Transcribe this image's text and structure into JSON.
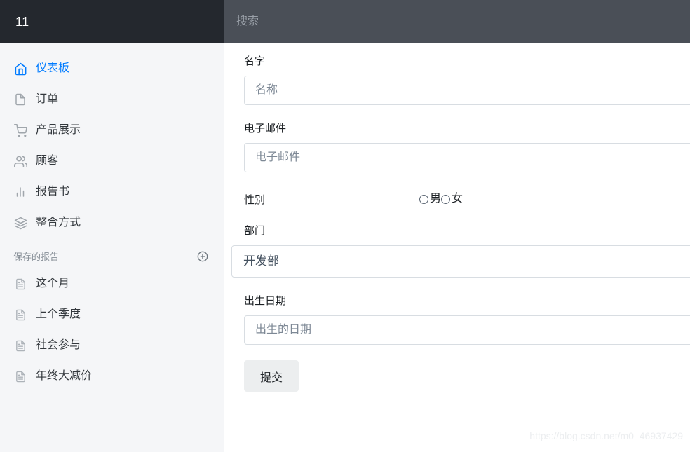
{
  "header": {
    "brand": "11",
    "search_placeholder": "搜索",
    "search_value": ""
  },
  "sidebar": {
    "items": [
      {
        "label": "仪表板",
        "icon": "home-icon",
        "active": true
      },
      {
        "label": "订单",
        "icon": "file-icon",
        "active": false
      },
      {
        "label": "产品展示",
        "icon": "shopping-cart-icon",
        "active": false
      },
      {
        "label": "顾客",
        "icon": "users-icon",
        "active": false
      },
      {
        "label": "报告书",
        "icon": "bar-chart-icon",
        "active": false
      },
      {
        "label": "整合方式",
        "icon": "layers-icon",
        "active": false
      }
    ],
    "saved_section": {
      "title": "保存的报告",
      "add_icon": "plus-circle-icon",
      "items": [
        {
          "label": "这个月",
          "icon": "file-text-icon"
        },
        {
          "label": "上个季度",
          "icon": "file-text-icon"
        },
        {
          "label": "社会参与",
          "icon": "file-text-icon"
        },
        {
          "label": "年终大减价",
          "icon": "file-text-icon"
        }
      ]
    }
  },
  "form": {
    "name": {
      "label": "名字",
      "placeholder": "名称",
      "value": ""
    },
    "email": {
      "label": "电子邮件",
      "placeholder": "电子邮件",
      "value": ""
    },
    "gender": {
      "label": "性别",
      "options": [
        {
          "label": "男",
          "selected": false
        },
        {
          "label": "女",
          "selected": false
        }
      ]
    },
    "department": {
      "label": "部门",
      "selected": "开发部"
    },
    "birthday": {
      "label": "出生日期",
      "placeholder": "出生的日期",
      "value": ""
    },
    "submit_label": "提交"
  },
  "watermark": "https://blog.csdn.net/m0_46937429",
  "colors": {
    "brand_bar": "#24282e",
    "search_bar": "#4a4f57",
    "sidebar_bg": "#f5f6f8",
    "accent": "#007bff",
    "muted_text": "#868e96",
    "button_bg": "#eceeef"
  }
}
